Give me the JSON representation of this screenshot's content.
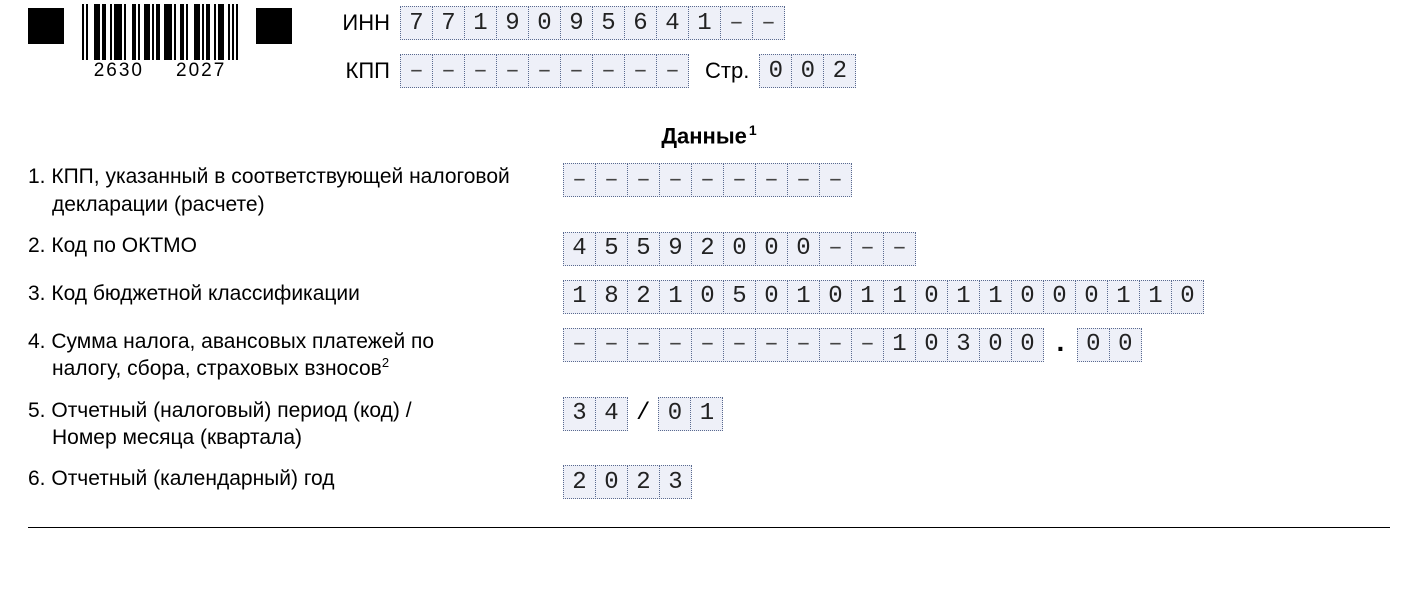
{
  "barcode": {
    "left": "2630",
    "right": "2027"
  },
  "header": {
    "inn_label": "ИНН",
    "inn": "7719095641--",
    "kpp_label": "КПП",
    "kpp": "---------",
    "page_label": "Стр.",
    "page": "002"
  },
  "section_title": "Данные",
  "section_title_sup": "1",
  "rows": [
    {
      "num": "1.",
      "label_l1": "КПП, указанный в соответствующей налоговой",
      "label_l2": "декларации (расчете)",
      "value": "---------"
    },
    {
      "num": "2.",
      "label_l1": "Код по ОКТМО",
      "value": "45592000---"
    },
    {
      "num": "3.",
      "label_l1": "Код бюджетной классификации",
      "value": "18210501011011000110"
    },
    {
      "num": "4.",
      "label_l1": "Сумма налога, авансовых платежей по",
      "label_l2": "налогу, сбора, страховых взносов",
      "sup": "2",
      "value_int": "----------10300",
      "value_dec": "00"
    },
    {
      "num": "5.",
      "label_l1": "Отчетный (налоговый) период (код) /",
      "label_l2": "Номер месяца (квартала)",
      "value_a": "34",
      "value_b": "01"
    },
    {
      "num": "6.",
      "label_l1": "Отчетный (календарный) год",
      "value": "2023"
    }
  ]
}
